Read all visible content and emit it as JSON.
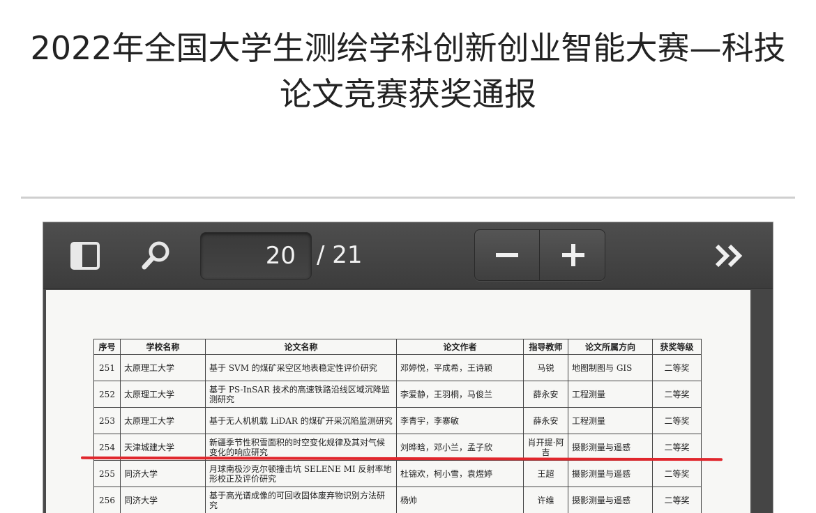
{
  "article": {
    "title": "2022年全国大学生测绘学科创新创业智能大赛—科技论文竞赛获奖通报"
  },
  "viewer": {
    "page_current": "20",
    "page_total": "/ 21",
    "icons": {
      "sidebar": "sidebar-toggle-icon",
      "search": "search-icon",
      "zoom_out": "minus-icon",
      "zoom_in": "plus-icon",
      "more": "double-chevron-right-icon"
    },
    "colors": {
      "toolbar": "#444444",
      "highlight": "#e0262c"
    }
  },
  "table": {
    "headers": [
      "序号",
      "学校名称",
      "论文名称",
      "论文作者",
      "指导教师",
      "论文所属方向",
      "获奖等级"
    ],
    "rows": [
      [
        "251",
        "太原理工大学",
        "基于 SVM 的煤矿采空区地表稳定性评价研究",
        "邓婷悦，平成希，王诗颖",
        "马锐",
        "地图制图与 GIS",
        "二等奖"
      ],
      [
        "252",
        "太原理工大学",
        "基于 PS-InSAR 技术的高速铁路沿线区域沉降监测研究",
        "李爱静，王羽桐，马俊兰",
        "薛永安",
        "工程测量",
        "二等奖"
      ],
      [
        "253",
        "太原理工大学",
        "基于无人机机载 LiDAR 的煤矿开采沉陷监测研究",
        "李青宇，李寨敏",
        "薛永安",
        "工程测量",
        "二等奖"
      ],
      [
        "254",
        "天津城建大学",
        "新疆季节性积雪面积的时空变化规律及其对气候变化的响应研究",
        "刘晔晗，邓小兰，孟子欣",
        "肖开提·阿吉",
        "摄影测量与遥感",
        "二等奖"
      ],
      [
        "255",
        "同济大学",
        "月球南极沙克尔顿撞击坑 SELENE MI 反射率地形校正及评价研究",
        "杜锦欢，柯小雪，袁煜婷",
        "王超",
        "摄影测量与遥感",
        "二等奖"
      ],
      [
        "256",
        "同济大学",
        "基于高光谱成像的可回收固体废弃物识别方法研究",
        "杨帅",
        "许维",
        "摄影测量与遥感",
        "二等奖"
      ]
    ]
  }
}
